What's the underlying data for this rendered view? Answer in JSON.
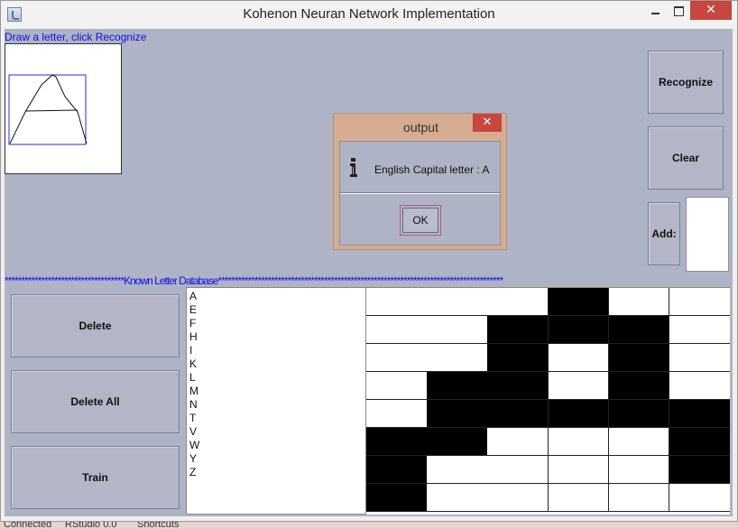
{
  "window": {
    "title": "Kohenon Neuran Network Implementation",
    "close_glyph": "✕"
  },
  "draw": {
    "instruction": "Draw a letter, click Recognize"
  },
  "buttons": {
    "recognize": "Recognize",
    "clear": "Clear",
    "add": "Add:",
    "delete": "Delete",
    "delete_all": "Delete All",
    "train": "Train"
  },
  "database": {
    "label": "************************************Known Letter Database**************************************************************************************",
    "letters": [
      "A",
      "E",
      "F",
      "H",
      "I",
      "K",
      "L",
      "M",
      "N",
      "T",
      "V",
      "W",
      "Y",
      "Z"
    ]
  },
  "grid": {
    "cols": 6,
    "rows": 8,
    "cells": [
      [
        0,
        0,
        0,
        1,
        0,
        0
      ],
      [
        0,
        0,
        1,
        1,
        1,
        0
      ],
      [
        0,
        0,
        1,
        0,
        1,
        0
      ],
      [
        0,
        1,
        1,
        0,
        1,
        0
      ],
      [
        0,
        1,
        1,
        1,
        1,
        1
      ],
      [
        1,
        1,
        0,
        0,
        0,
        1
      ],
      [
        1,
        0,
        0,
        0,
        0,
        1
      ],
      [
        1,
        0,
        0,
        0,
        0,
        0
      ]
    ]
  },
  "dialog": {
    "title": "output",
    "message": "English Capital letter : A",
    "ok_label": "OK",
    "close_glyph": "✕"
  },
  "status": {
    "items": [
      "Connected",
      "RStudio 0.0",
      "Shortcuts"
    ]
  },
  "colors": {
    "client_bg": "#aeb3c6",
    "label_blue": "#1010e8",
    "close_red": "#c7463d"
  }
}
